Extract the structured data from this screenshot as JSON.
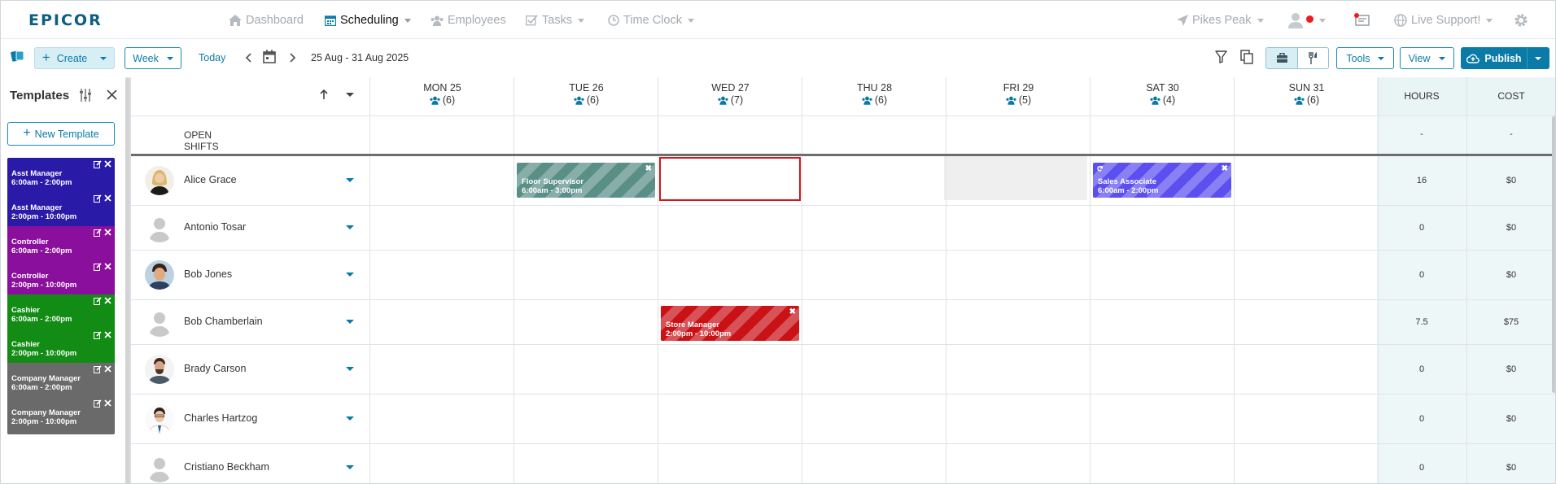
{
  "brand": {
    "name": "EPICOR"
  },
  "nav": {
    "dashboard": "Dashboard",
    "scheduling": "Scheduling",
    "employees": "Employees",
    "tasks": "Tasks",
    "timeclock": "Time Clock",
    "location": "Pikes Peak",
    "support": "Live Support!"
  },
  "toolbar": {
    "create": "Create",
    "week": "Week",
    "today": "Today",
    "date_range": "25 Aug - 31 Aug 2025",
    "tools": "Tools",
    "view": "View",
    "publish": "Publish"
  },
  "templates": {
    "title": "Templates",
    "new_label": "New Template",
    "items": [
      {
        "title": "Asst Manager",
        "time": "6:00am - 2:00pm",
        "color": "#2a1aa8"
      },
      {
        "title": "Asst Manager",
        "time": "2:00pm - 10:00pm",
        "color": "#2a1aa8"
      },
      {
        "title": "Controller",
        "time": "6:00am - 2:00pm",
        "color": "#8a0f9c"
      },
      {
        "title": "Controller",
        "time": "2:00pm - 10:00pm",
        "color": "#8a0f9c"
      },
      {
        "title": "Cashier",
        "time": "6:00am - 2:00pm",
        "color": "#128c14"
      },
      {
        "title": "Cashier",
        "time": "2:00pm - 10:00pm",
        "color": "#128c14"
      },
      {
        "title": "Company Manager",
        "time": "6:00am - 2:00pm",
        "color": "#6a6a6a"
      },
      {
        "title": "Company Manager",
        "time": "2:00pm - 10:00pm",
        "color": "#6a6a6a"
      }
    ]
  },
  "grid": {
    "days": [
      {
        "label": "MON 25",
        "count": "(6)"
      },
      {
        "label": "TUE 26",
        "count": "(6)"
      },
      {
        "label": "WED 27",
        "count": "(7)"
      },
      {
        "label": "THU 28",
        "count": "(6)"
      },
      {
        "label": "FRI 29",
        "count": "(5)"
      },
      {
        "label": "SAT 30",
        "count": "(4)"
      },
      {
        "label": "SUN 31",
        "count": "(6)"
      }
    ],
    "hours_header": "HOURS",
    "cost_header": "COST",
    "open_shifts": {
      "label": "OPEN SHIFTS",
      "hours": "-",
      "cost": "-"
    },
    "employees": [
      {
        "name": "Alice Grace",
        "hours": "16",
        "cost": "$0"
      },
      {
        "name": "Antonio Tosar",
        "hours": "0",
        "cost": "$0"
      },
      {
        "name": "Bob Jones",
        "hours": "0",
        "cost": "$0"
      },
      {
        "name": "Bob Chamberlain",
        "hours": "7.5",
        "cost": "$75"
      },
      {
        "name": "Brady Carson",
        "hours": "0",
        "cost": "$0"
      },
      {
        "name": "Charles Hartzog",
        "hours": "0",
        "cost": "$0"
      },
      {
        "name": "Cristiano Beckham",
        "hours": "0",
        "cost": "$0"
      }
    ],
    "shifts": [
      {
        "title": "Floor Supervisor",
        "time": "6:00am - 3:00pm",
        "color": "#5a8f88"
      },
      {
        "title": "Sales Associate",
        "time": "6:00am - 2:00pm",
        "color": "#5b4ff0"
      },
      {
        "title": "Store Manager",
        "time": "2:00pm - 10:00pm",
        "color": "#c91116"
      }
    ]
  }
}
